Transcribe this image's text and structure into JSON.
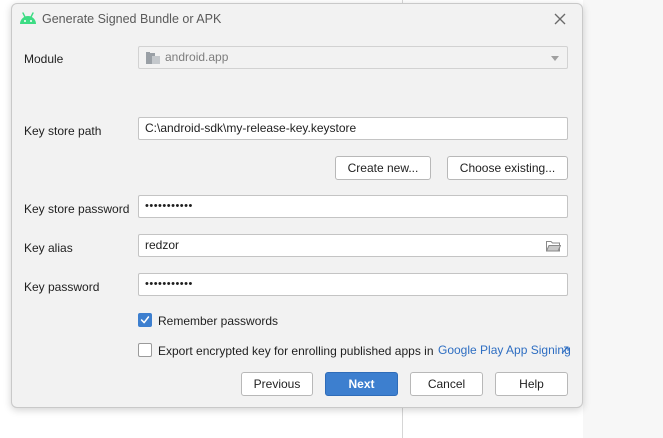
{
  "dialog": {
    "title": "Generate Signed Bundle or APK"
  },
  "form": {
    "module_label": "Module",
    "module_value": "android.app",
    "key_store_path_label": "Key store path",
    "key_store_path_value": "C:\\android-sdk\\my-release-key.keystore",
    "create_new_label": "Create new...",
    "choose_existing_label": "Choose existing...",
    "key_store_password_label": "Key store password",
    "key_store_password_value": "•••••••••••",
    "key_alias_label": "Key alias",
    "key_alias_value": "redzor",
    "key_password_label": "Key password",
    "key_password_value": "•••••••••••",
    "remember_passwords_label": "Remember passwords",
    "remember_passwords_checked": true,
    "export_key_label": "Export encrypted key for enrolling published apps in",
    "export_key_checked": false,
    "google_play_link": "Google Play App Signing"
  },
  "footer": {
    "previous_label": "Previous",
    "next_label": "Next",
    "cancel_label": "Cancel",
    "help_label": "Help"
  },
  "colors": {
    "accent": "#3d7fcf",
    "link": "#2e6ec2",
    "android_green": "#3ddc84"
  },
  "icons": {
    "title": "android-icon",
    "close": "close-icon",
    "module": "module-icon",
    "dropdown": "chevron-down-icon",
    "browse": "folder-icon",
    "checkbox": "checkmark-icon",
    "external_link": "external-link-icon"
  }
}
